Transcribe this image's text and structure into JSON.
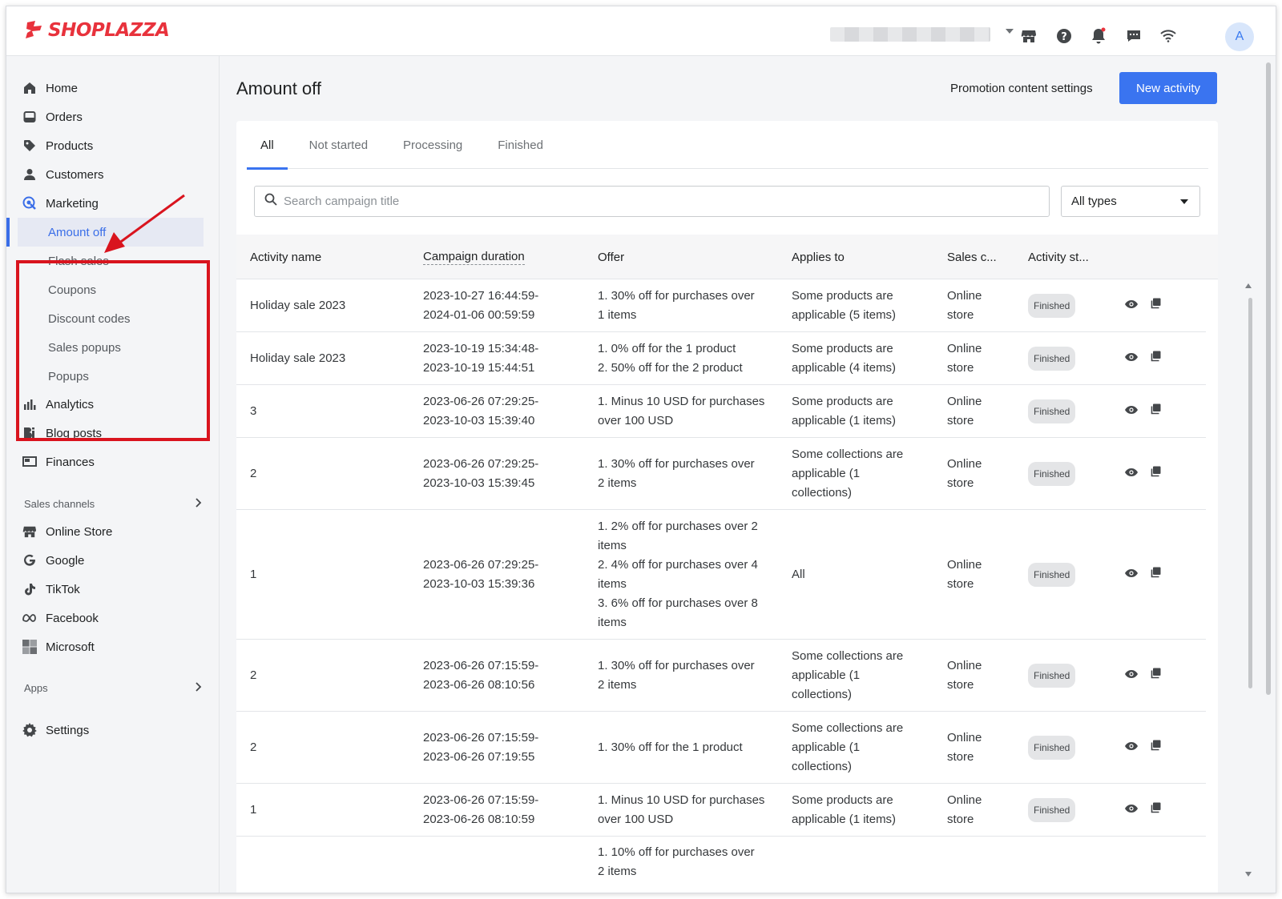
{
  "app": {
    "logo_text": "SHOPLAZZA",
    "avatar_initial": "A"
  },
  "topbar": {
    "icons": [
      "store-icon",
      "help-icon",
      "bell-icon",
      "chat-icon",
      "wifi-icon"
    ]
  },
  "sidebar": {
    "items": [
      {
        "label": "Home",
        "icon": "home-icon"
      },
      {
        "label": "Orders",
        "icon": "orders-icon"
      },
      {
        "label": "Products",
        "icon": "tag-icon"
      },
      {
        "label": "Customers",
        "icon": "person-icon"
      },
      {
        "label": "Marketing",
        "icon": "marketing-icon"
      }
    ],
    "marketing_sub": [
      "Amount off",
      "Flash sales",
      "Coupons",
      "Discount codes",
      "Sales popups",
      "Popups"
    ],
    "items2": [
      {
        "label": "Analytics",
        "icon": "analytics-icon"
      },
      {
        "label": "Blog posts",
        "icon": "blog-icon"
      },
      {
        "label": "Finances",
        "icon": "finances-icon"
      }
    ],
    "sales_channels_label": "Sales channels",
    "channels": [
      {
        "label": "Online Store",
        "icon": "store-icon"
      },
      {
        "label": "Google",
        "icon": "google-icon"
      },
      {
        "label": "TikTok",
        "icon": "tiktok-icon"
      },
      {
        "label": "Facebook",
        "icon": "meta-icon"
      },
      {
        "label": "Microsoft",
        "icon": "microsoft-icon"
      }
    ],
    "apps_label": "Apps",
    "settings_label": "Settings"
  },
  "main": {
    "title": "Amount off",
    "promo_link": "Promotion content settings",
    "new_button": "New activity",
    "tabs": [
      "All",
      "Not started",
      "Processing",
      "Finished"
    ],
    "search_placeholder": "Search campaign title",
    "type_filter": "All types",
    "columns": [
      "Activity name",
      "Campaign duration",
      "Offer",
      "Applies to",
      "Sales c...",
      "Activity st..."
    ],
    "rows": [
      {
        "name": "Holiday sale 2023",
        "duration": [
          "2023-10-27 16:44:59-",
          "2024-01-06 00:59:59"
        ],
        "offer": [
          "1. 30% off for purchases over",
          "1 items"
        ],
        "applies": [
          "Some products are",
          "applicable (5 items)"
        ],
        "channel": [
          "Online",
          "store"
        ],
        "status": "Finished"
      },
      {
        "name": "Holiday sale 2023",
        "duration": [
          "2023-10-19 15:34:48-",
          "2023-10-19 15:44:51"
        ],
        "offer": [
          "1. 0% off for the 1 product",
          "2. 50% off for the 2 product"
        ],
        "applies": [
          "Some products are",
          "applicable (4 items)"
        ],
        "channel": [
          "Online",
          "store"
        ],
        "status": "Finished"
      },
      {
        "name": "3",
        "duration": [
          "2023-06-26 07:29:25-",
          "2023-10-03 15:39:40"
        ],
        "offer": [
          "1. Minus 10 USD for purchases",
          "over 100 USD"
        ],
        "applies": [
          "Some products are",
          "applicable (1 items)"
        ],
        "channel": [
          "Online",
          "store"
        ],
        "status": "Finished"
      },
      {
        "name": "2",
        "duration": [
          "2023-06-26 07:29:25-",
          "2023-10-03 15:39:45"
        ],
        "offer": [
          "1. 30% off for purchases over",
          "2 items"
        ],
        "applies": [
          "Some collections are",
          "applicable (1",
          "collections)"
        ],
        "channel": [
          "Online",
          "store"
        ],
        "status": "Finished"
      },
      {
        "name": "1",
        "duration": [
          "2023-06-26 07:29:25-",
          "2023-10-03 15:39:36"
        ],
        "offer": [
          "1. 2% off for purchases over 2",
          "items",
          "2. 4% off for purchases over 4",
          "items",
          "3. 6% off for purchases over 8",
          "items"
        ],
        "applies": [
          "All"
        ],
        "channel": [
          "Online",
          "store"
        ],
        "status": "Finished"
      },
      {
        "name": "2",
        "duration": [
          "2023-06-26 07:15:59-",
          "2023-06-26 08:10:56"
        ],
        "offer": [
          "1. 30% off for purchases over",
          "2 items"
        ],
        "applies": [
          "Some collections are",
          "applicable (1",
          "collections)"
        ],
        "channel": [
          "Online",
          "store"
        ],
        "status": "Finished"
      },
      {
        "name": "2",
        "duration": [
          "2023-06-26 07:15:59-",
          "2023-06-26 07:19:55"
        ],
        "offer": [
          "1. 30% off for the 1 product"
        ],
        "applies": [
          "Some collections are",
          "applicable (1",
          "collections)"
        ],
        "channel": [
          "Online",
          "store"
        ],
        "status": "Finished"
      },
      {
        "name": "1",
        "duration": [
          "2023-06-26 07:15:59-",
          "2023-06-26 08:10:59"
        ],
        "offer": [
          "1. Minus 10 USD for purchases",
          "over 100 USD"
        ],
        "applies": [
          "Some products are",
          "applicable (1 items)"
        ],
        "channel": [
          "Online",
          "store"
        ],
        "status": "Finished"
      },
      {
        "name": "",
        "duration": [],
        "offer": [
          "1. 10% off for purchases over",
          "2 items"
        ],
        "applies": [],
        "channel": [],
        "status": ""
      }
    ]
  },
  "colors": {
    "brand": "#e8323c",
    "accent": "#3a74f0",
    "highlight": "#d9141e"
  }
}
